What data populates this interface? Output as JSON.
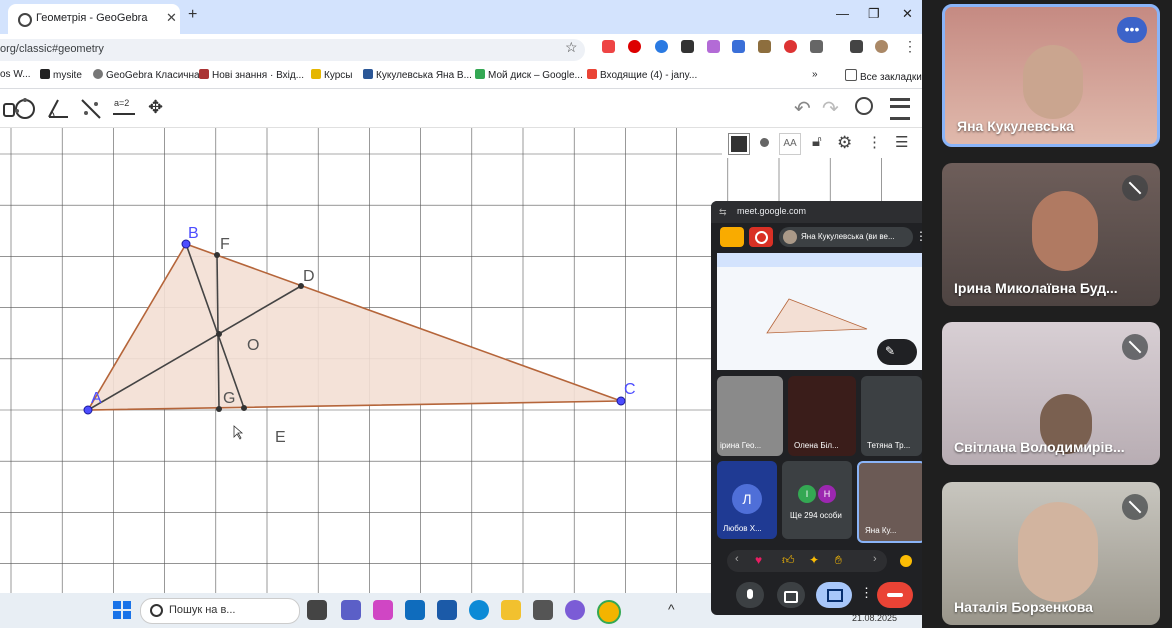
{
  "browser": {
    "tab_title": "Геометрія - GeoGebra",
    "url": "org/classic#geometry",
    "bookmarks": [
      "os W...",
      "mysite",
      "GeoGebra Класична",
      "Нові знання · Вхід...",
      "Курсы",
      "Кукулевська Яна В...",
      "Мой диск – Google...",
      "Входящие (4) - jany...",
      "Все закладки"
    ]
  },
  "geogebra": {
    "labels": {
      "A": "A",
      "B": "B",
      "C": "C",
      "D": "D",
      "E": "E",
      "F": "F",
      "G": "G",
      "O": "O"
    },
    "toolbar_value": "a=2"
  },
  "taskbar": {
    "search_placeholder": "Пошук на в...",
    "date": "21.08.2025"
  },
  "meet_popup": {
    "site": "meet.google.com",
    "presenter": "Яна Кукулевська (ви ве...",
    "tiles": [
      "ірина Гео...",
      "Олена Біл...",
      "Тетяна Тр...",
      "Любов Х...",
      "Ще 294 особи",
      "Яна Ку..."
    ],
    "avatar_letter": "Л",
    "mini_avatars": [
      "І",
      "Н"
    ]
  },
  "participants": [
    {
      "name": "Яна Кукулевська",
      "muted": false
    },
    {
      "name": "Ірина Миколаївна Буд...",
      "muted": true
    },
    {
      "name": "Світлана Володимирів...",
      "muted": true
    },
    {
      "name": "Наталія Борзенкова",
      "muted": true
    }
  ],
  "colors": {
    "accent": "#1a73e8",
    "triangle_fill": "#f3dfd4",
    "triangle_edge": "#b5653a",
    "point": "#4d4dff",
    "end_call": "#ea4335"
  }
}
